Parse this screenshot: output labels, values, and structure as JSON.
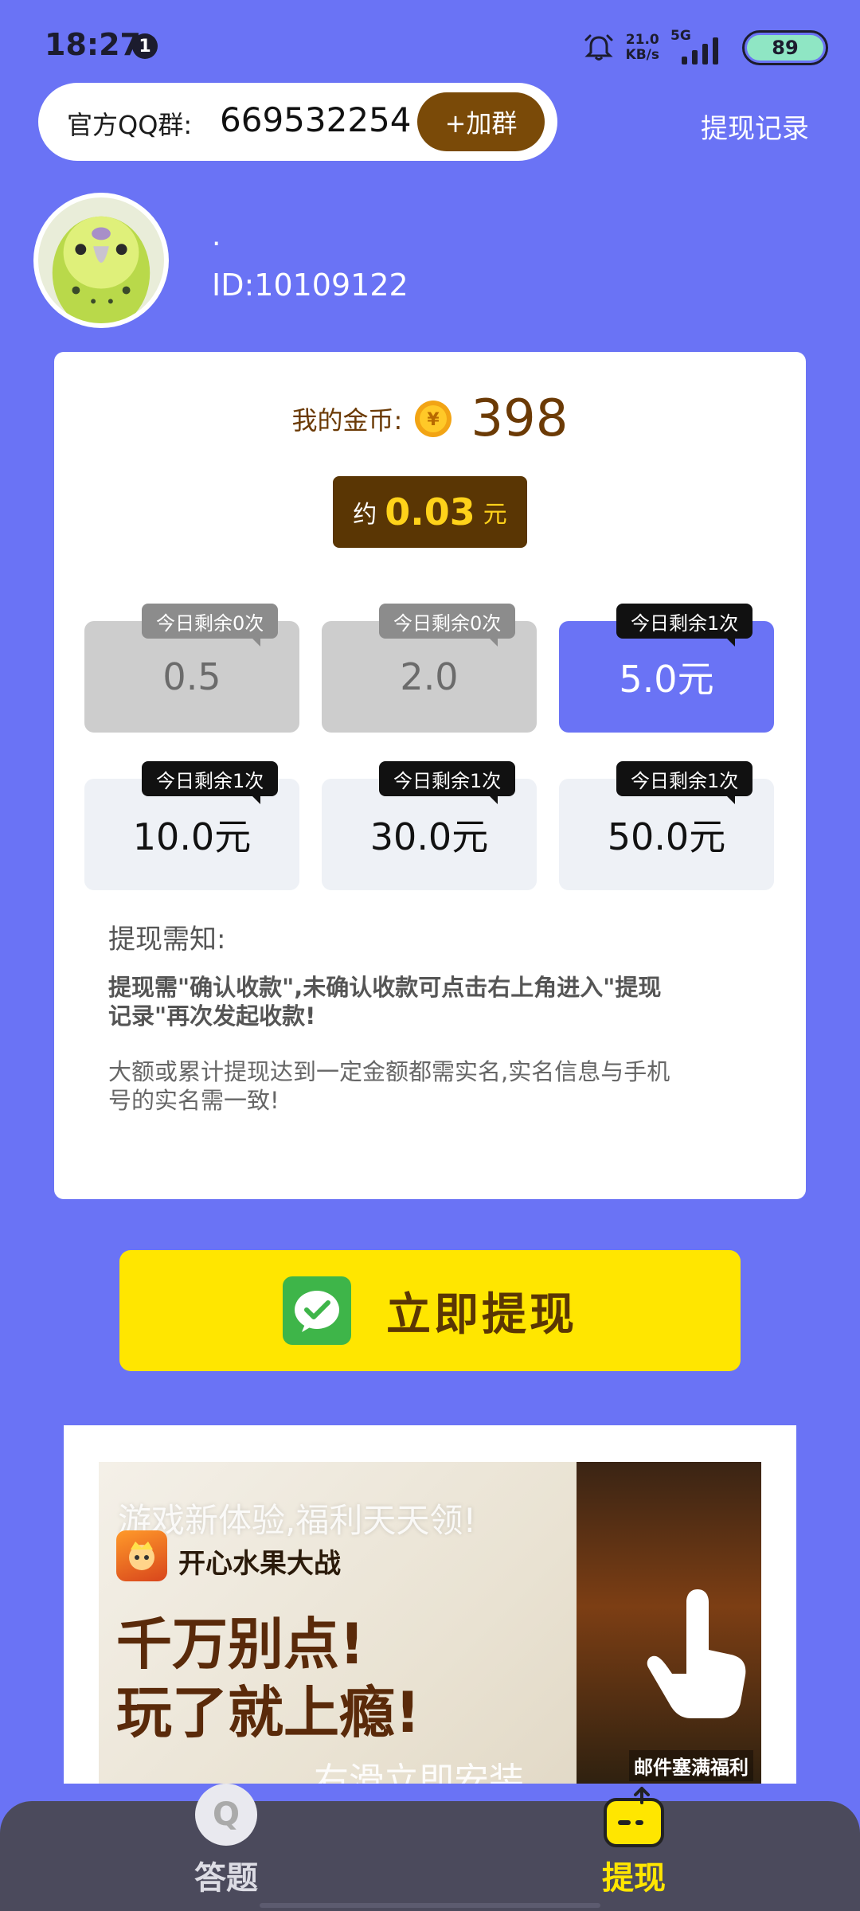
{
  "status_bar": {
    "time": "18:27",
    "notification_count": "1",
    "net_speed_value": "21.0",
    "net_speed_unit": "KB/s",
    "network_type": "5G",
    "battery": "89"
  },
  "header": {
    "qq_label": "官方QQ群:",
    "qq_number": "669532254",
    "join_button": "+加群",
    "withdraw_record": "提现记录"
  },
  "profile": {
    "name": "·",
    "id": "ID:10109122"
  },
  "wallet": {
    "coin_label": "我的金币:",
    "coin_value": "398",
    "approx_prefix": "约",
    "approx_value": "0.03",
    "approx_unit": "元"
  },
  "options": [
    {
      "amount": "0.5",
      "tag": "今日剩余0次",
      "state": "disabled"
    },
    {
      "amount": "2.0",
      "tag": "今日剩余0次",
      "state": "disabled"
    },
    {
      "amount": "5.0元",
      "tag": "今日剩余1次",
      "state": "selected"
    },
    {
      "amount": "10.0元",
      "tag": "今日剩余1次",
      "state": "normal"
    },
    {
      "amount": "30.0元",
      "tag": "今日剩余1次",
      "state": "normal"
    },
    {
      "amount": "50.0元",
      "tag": "今日剩余1次",
      "state": "normal"
    }
  ],
  "notice": {
    "title": "提现需知:",
    "bold_text": "提现需\"确认收款\",未确认收款可点击右上角进入\"提现记录\"再次发起收款!",
    "text": "大额或累计提现达到一定金额都需实名,实名信息与手机号的实名需一致!"
  },
  "action": {
    "withdraw_now": "立即提现"
  },
  "ad": {
    "slogan": "游戏新体验,福利天天领!",
    "app_name": "开心水果大战",
    "headline_line1": "千万别点!",
    "headline_line2": "玩了就上瘾!",
    "install_hint": "右滑立即安装",
    "mail_reward": "邮件塞满福利"
  },
  "bottom_nav": {
    "answer_icon_letter": "Q",
    "answer_label": "答题",
    "withdraw_label": "提现"
  },
  "colors": {
    "background": "#6a73f5",
    "brown": "#5a3604",
    "yellow": "#ffe600",
    "nav_bg": "#4b4a5c"
  }
}
